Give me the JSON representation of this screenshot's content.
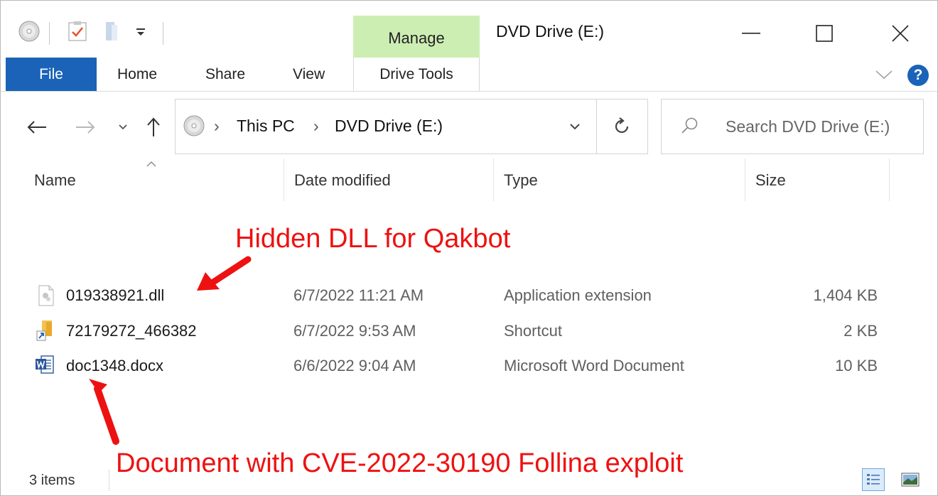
{
  "window": {
    "title": "DVD Drive (E:)",
    "contextual_tab_group": "Manage"
  },
  "ribbon": {
    "tabs": [
      "File",
      "Home",
      "Share",
      "View"
    ],
    "contextual_tab": "Drive Tools"
  },
  "address_bar": {
    "breadcrumbs": [
      "This PC",
      "DVD Drive (E:)"
    ]
  },
  "search": {
    "placeholder": "Search DVD Drive (E:)"
  },
  "columns": [
    "Name",
    "Date modified",
    "Type",
    "Size"
  ],
  "files": [
    {
      "name": "019338921.dll",
      "date": "6/7/2022 11:21 AM",
      "type": "Application extension",
      "size": "1,404 KB",
      "icon": "dll-file-icon"
    },
    {
      "name": "72179272_466382",
      "date": "6/7/2022 9:53 AM",
      "type": "Shortcut",
      "size": "2 KB",
      "icon": "shortcut-icon"
    },
    {
      "name": "doc1348.docx",
      "date": "6/6/2022 9:04 AM",
      "type": "Microsoft Word Document",
      "size": "10 KB",
      "icon": "word-document-icon"
    }
  ],
  "status": {
    "item_count": "3 items"
  },
  "annotations": {
    "dll_note": "Hidden DLL for Qakbot",
    "doc_note": "Document with CVE-2022-30190 Follina exploit"
  },
  "colors": {
    "file_tab": "#1a63b8",
    "manage_tab": "#cdeeb3",
    "annotation": "#ee1111"
  }
}
